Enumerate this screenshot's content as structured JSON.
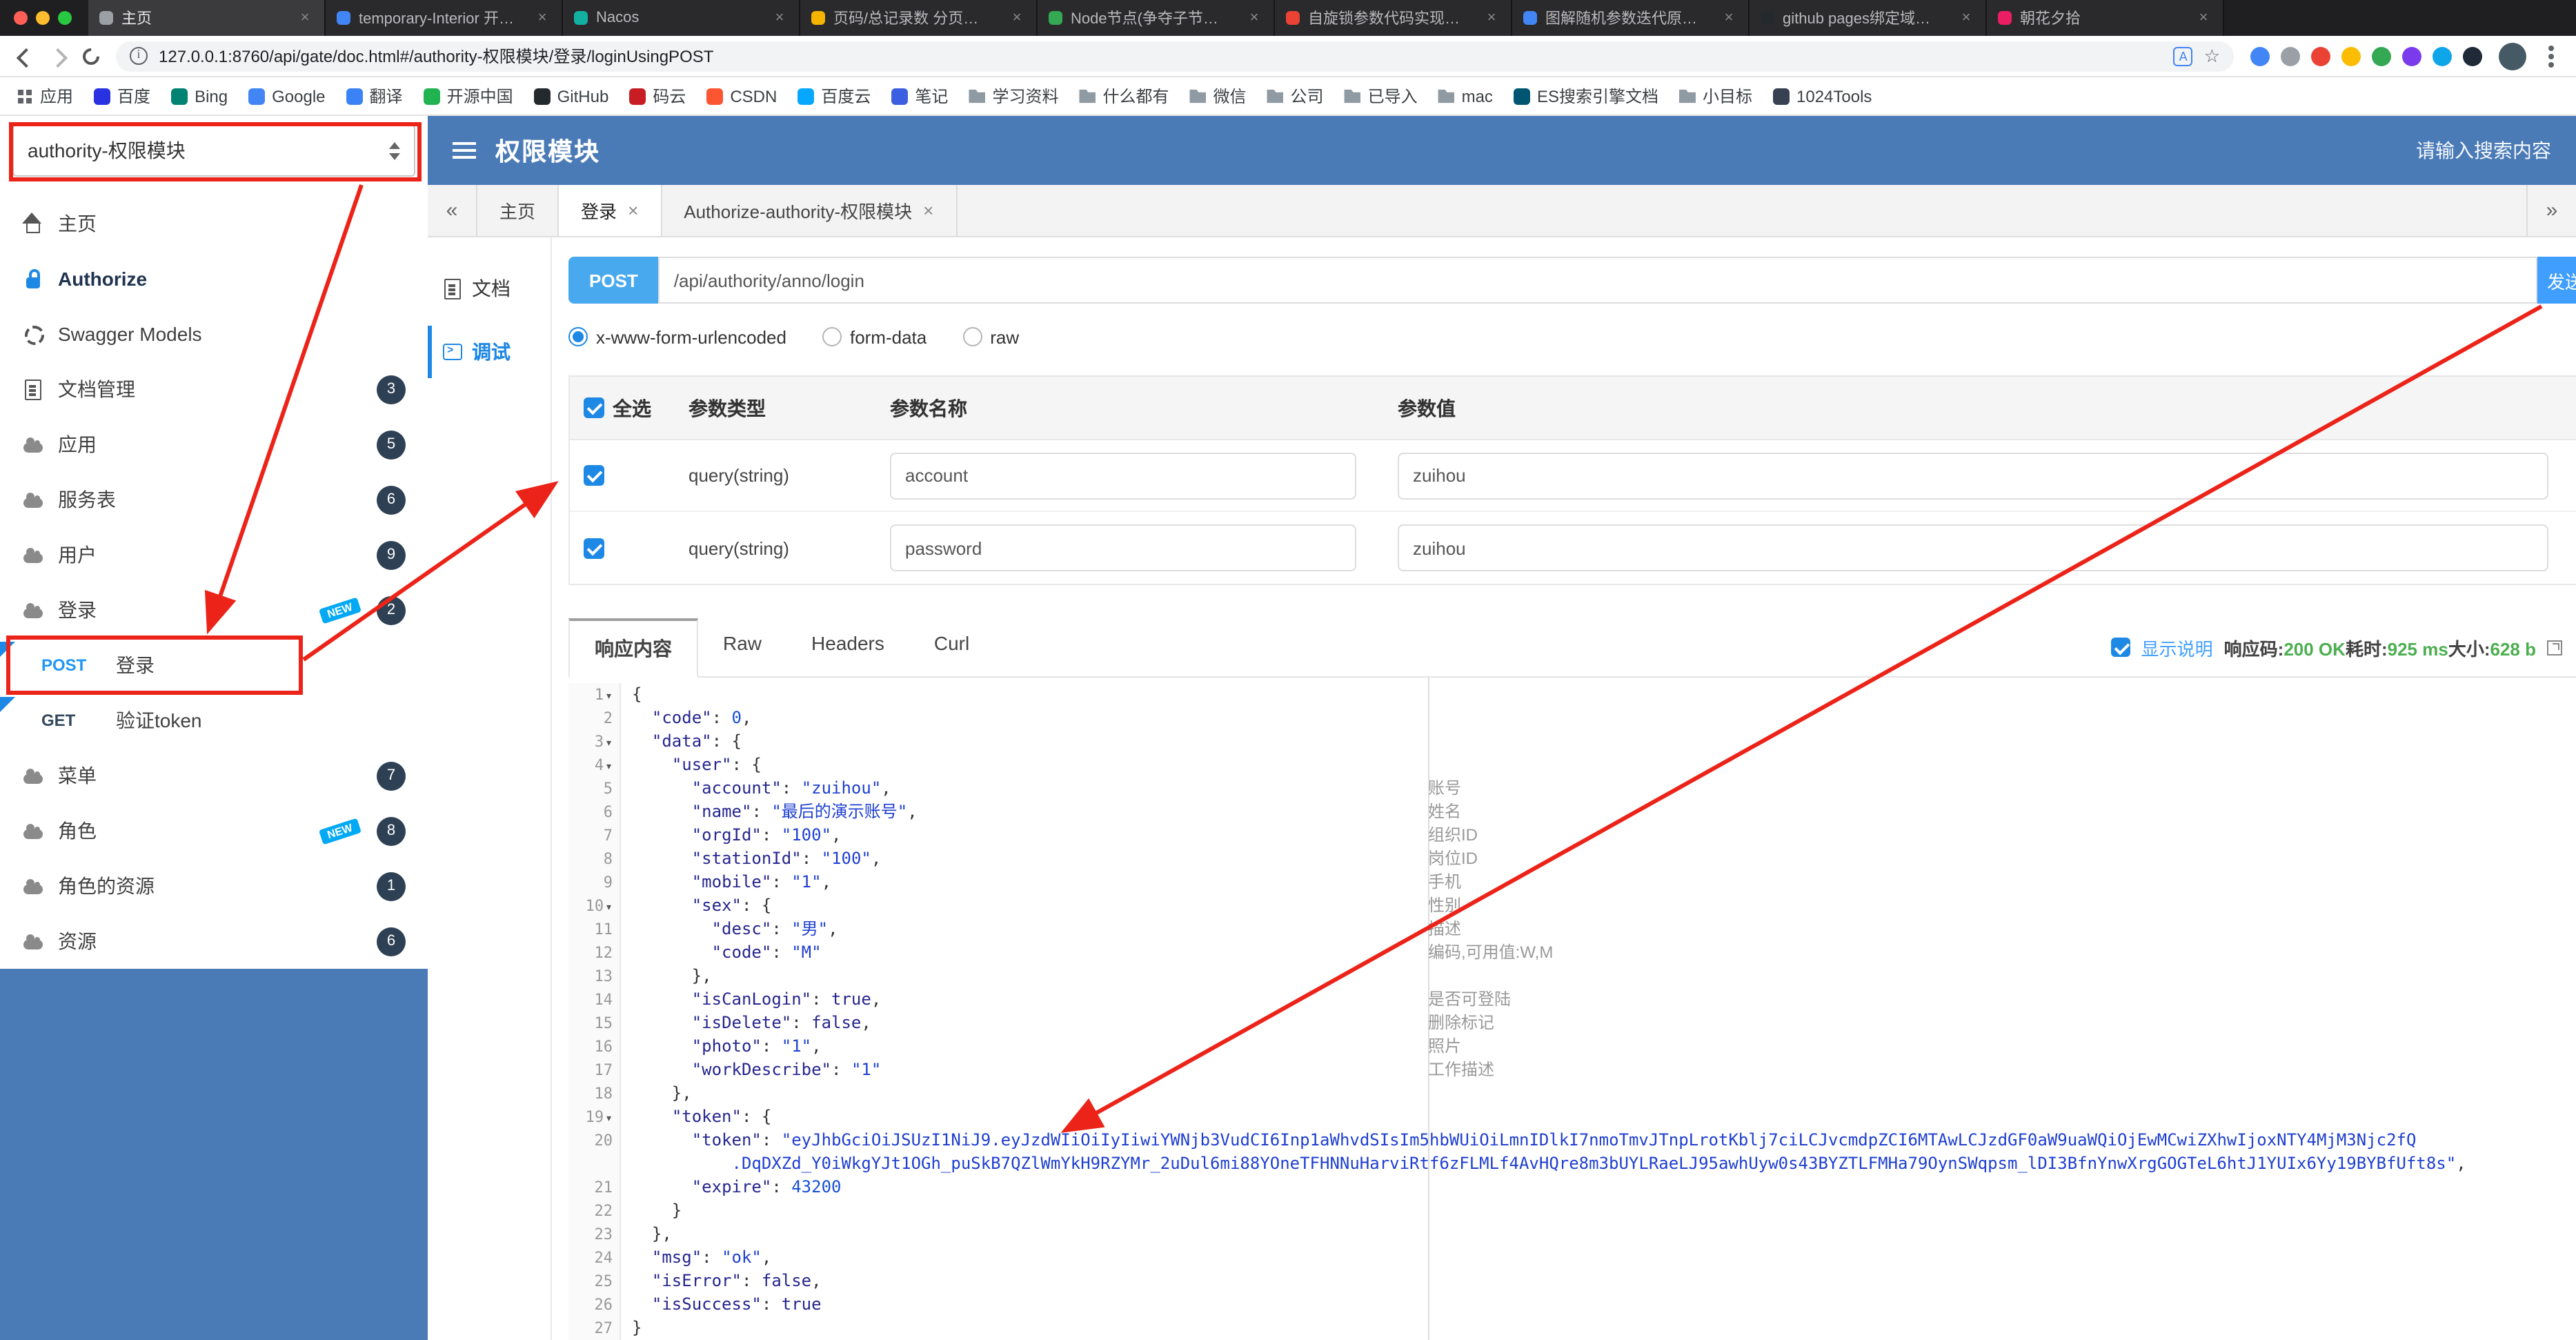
{
  "colors": {
    "header_blue": "#4a7bb7",
    "annotation_red": "#ec2318",
    "method_post_blue": "#2196f3",
    "status_green": "#4caf50",
    "badge_navy": "#2e4053"
  },
  "browser": {
    "url": "127.0.0.1:8760/api/gate/doc.html#/authority-权限模块/登录/loginUsingPOST",
    "tabs": [
      {
        "title": "主页",
        "color": "#9aa0a6"
      },
      {
        "title": "temporary-Interior 开…",
        "color": "#4285f4"
      },
      {
        "title": "Nacos",
        "color": "#12b0a0"
      },
      {
        "title": "页码/总记录数 分页…",
        "color": "#f4b400"
      },
      {
        "title": "Node节点(争夺子节…",
        "color": "#34a853"
      },
      {
        "title": "自旋锁参数代码实现…",
        "color": "#ea4335"
      },
      {
        "title": "图解随机参数迭代原…",
        "color": "#4285f4"
      },
      {
        "title": "github pages绑定域…",
        "color": "#24292e"
      },
      {
        "title": "朝花夕拾",
        "color": "#e91e63"
      }
    ],
    "actions": [
      {
        "color": "#4285f4"
      },
      {
        "color": "#9aa0a6"
      },
      {
        "color": "#ea4335"
      },
      {
        "color": "#fbbc04"
      },
      {
        "color": "#34a853"
      },
      {
        "color": "#7c3aed"
      },
      {
        "color": "#0ea5e9"
      },
      {
        "color": "#1f2937"
      }
    ],
    "bookmarks": [
      {
        "label": "应用",
        "type": "apps"
      },
      {
        "label": "百度",
        "color": "#2932e1"
      },
      {
        "label": "Bing",
        "color": "#008373"
      },
      {
        "label": "Google",
        "color": "#4285f4"
      },
      {
        "label": "翻译",
        "color": "#3b82f6"
      },
      {
        "label": "开源中国",
        "color": "#21b351"
      },
      {
        "label": "GitHub",
        "color": "#24292e"
      },
      {
        "label": "码云",
        "color": "#c71d23"
      },
      {
        "label": "CSDN",
        "color": "#fc5531"
      },
      {
        "label": "百度云",
        "color": "#06a7ff"
      },
      {
        "label": "笔记",
        "color": "#3b5fe0"
      },
      {
        "label": "学习资料",
        "folder": true
      },
      {
        "label": "什么都有",
        "folder": true
      },
      {
        "label": "微信",
        "folder": true
      },
      {
        "label": "公司",
        "folder": true
      },
      {
        "label": "已导入",
        "folder": true
      },
      {
        "label": "mac",
        "folder": true
      },
      {
        "label": "ES搜索引擎文档",
        "color": "#005571"
      },
      {
        "label": "小目标",
        "folder": true
      },
      {
        "label": "1024Tools",
        "color": "#374151"
      }
    ]
  },
  "header": {
    "group_select": "authority-权限模块",
    "title": "权限模块",
    "search_placeholder": "请输入搜索内容"
  },
  "sidebar": {
    "items": [
      {
        "label": "主页",
        "icon": "home"
      },
      {
        "label": "Authorize",
        "icon": "lock",
        "bold": true
      },
      {
        "label": "Swagger Models",
        "icon": "models"
      },
      {
        "label": "文档管理",
        "icon": "doc",
        "badge": "3"
      },
      {
        "label": "应用",
        "icon": "cloud",
        "badge": "5"
      },
      {
        "label": "服务表",
        "icon": "cloud",
        "badge": "6"
      },
      {
        "label": "用户",
        "icon": "cloud",
        "badge": "9"
      },
      {
        "label": "登录",
        "icon": "cloud",
        "badge": "2",
        "new_label": "NEW"
      },
      {
        "label": "登录",
        "method": "POST",
        "method_class": "post",
        "sub": true
      },
      {
        "label": "验证token",
        "method": "GET",
        "method_class": "get",
        "sub": true
      },
      {
        "label": "菜单",
        "icon": "cloud",
        "badge": "7"
      },
      {
        "label": "角色",
        "icon": "cloud",
        "badge": "8",
        "new_label": "NEW"
      },
      {
        "label": "角色的资源",
        "icon": "cloud",
        "badge": "1"
      },
      {
        "label": "资源",
        "icon": "cloud",
        "badge": "6"
      }
    ]
  },
  "doc_tabs": {
    "back": "«",
    "forward": "»",
    "items": [
      {
        "label": "主页"
      },
      {
        "label": "登录",
        "closable": true,
        "active": true
      },
      {
        "label": "Authorize-authority-权限模块",
        "closable": true
      }
    ]
  },
  "panel": {
    "items": [
      {
        "label": "文档",
        "icon": "doc"
      },
      {
        "label": "调试",
        "icon": "debug",
        "active": true
      }
    ]
  },
  "request": {
    "method": "POST",
    "url": "/api/authority/anno/login",
    "send_label": "发送",
    "content_types": [
      {
        "label": "x-www-form-urlencoded",
        "checked": true
      },
      {
        "label": "form-data"
      },
      {
        "label": "raw"
      }
    ]
  },
  "params": {
    "select_all": "全选",
    "col_type": "参数类型",
    "col_name": "参数名称",
    "col_value": "参数值",
    "rows": [
      {
        "type": "query(string)",
        "name": "account",
        "value": "zuihou",
        "checked": true
      },
      {
        "type": "query(string)",
        "name": "password",
        "value": "zuihou",
        "checked": true
      }
    ]
  },
  "response": {
    "tabs": [
      {
        "label": "响应内容",
        "active": true
      },
      {
        "label": "Raw"
      },
      {
        "label": "Headers"
      },
      {
        "label": "Curl"
      }
    ],
    "show_desc": "显示说明",
    "status_label": "响应码:",
    "status": "200 OK",
    "time_label": "耗时:",
    "time": "925 ms",
    "size_label": "大小:",
    "size": "628 b"
  },
  "code": {
    "rows": [
      {
        "ln": "1",
        "fold": true,
        "segs": [
          [
            "p",
            "{"
          ]
        ]
      },
      {
        "ln": "2",
        "segs": [
          [
            "p",
            "  "
          ],
          [
            "k",
            "\"code\""
          ],
          [
            "p",
            ": "
          ],
          [
            "n",
            "0"
          ],
          [
            "p",
            ","
          ]
        ]
      },
      {
        "ln": "3",
        "fold": true,
        "segs": [
          [
            "p",
            "  "
          ],
          [
            "k",
            "\"data\""
          ],
          [
            "p",
            ": {"
          ]
        ]
      },
      {
        "ln": "4",
        "fold": true,
        "segs": [
          [
            "p",
            "    "
          ],
          [
            "k",
            "\"user\""
          ],
          [
            "p",
            ": {"
          ]
        ]
      },
      {
        "ln": "5",
        "note": "账号",
        "segs": [
          [
            "p",
            "      "
          ],
          [
            "k",
            "\"account\""
          ],
          [
            "p",
            ": "
          ],
          [
            "s",
            "\"zuihou\""
          ],
          [
            "p",
            ","
          ]
        ]
      },
      {
        "ln": "6",
        "note": "姓名",
        "segs": [
          [
            "p",
            "      "
          ],
          [
            "k",
            "\"name\""
          ],
          [
            "p",
            ": "
          ],
          [
            "s",
            "\"最后的演示账号\""
          ],
          [
            "p",
            ","
          ]
        ]
      },
      {
        "ln": "7",
        "note": "组织ID",
        "segs": [
          [
            "p",
            "      "
          ],
          [
            "k",
            "\"orgId\""
          ],
          [
            "p",
            ": "
          ],
          [
            "s",
            "\"100\""
          ],
          [
            "p",
            ","
          ]
        ]
      },
      {
        "ln": "8",
        "note": "岗位ID",
        "segs": [
          [
            "p",
            "      "
          ],
          [
            "k",
            "\"stationId\""
          ],
          [
            "p",
            ": "
          ],
          [
            "s",
            "\"100\""
          ],
          [
            "p",
            ","
          ]
        ]
      },
      {
        "ln": "9",
        "note": "手机",
        "segs": [
          [
            "p",
            "      "
          ],
          [
            "k",
            "\"mobile\""
          ],
          [
            "p",
            ": "
          ],
          [
            "s",
            "\"1\""
          ],
          [
            "p",
            ","
          ]
        ]
      },
      {
        "ln": "10",
        "fold": true,
        "note": "性别",
        "segs": [
          [
            "p",
            "      "
          ],
          [
            "k",
            "\"sex\""
          ],
          [
            "p",
            ": {"
          ]
        ]
      },
      {
        "ln": "11",
        "note": "描述",
        "segs": [
          [
            "p",
            "        "
          ],
          [
            "k",
            "\"desc\""
          ],
          [
            "p",
            ": "
          ],
          [
            "s",
            "\"男\""
          ],
          [
            "p",
            ","
          ]
        ]
      },
      {
        "ln": "12",
        "note": "编码,可用值:W,M",
        "segs": [
          [
            "p",
            "        "
          ],
          [
            "k",
            "\"code\""
          ],
          [
            "p",
            ": "
          ],
          [
            "s",
            "\"M\""
          ]
        ]
      },
      {
        "ln": "13",
        "segs": [
          [
            "p",
            "      },"
          ]
        ]
      },
      {
        "ln": "14",
        "note": "是否可登陆",
        "segs": [
          [
            "p",
            "      "
          ],
          [
            "k",
            "\"isCanLogin\""
          ],
          [
            "p",
            ": "
          ],
          [
            "b",
            "true"
          ],
          [
            "p",
            ","
          ]
        ]
      },
      {
        "ln": "15",
        "note": "删除标记",
        "segs": [
          [
            "p",
            "      "
          ],
          [
            "k",
            "\"isDelete\""
          ],
          [
            "p",
            ": "
          ],
          [
            "b",
            "false"
          ],
          [
            "p",
            ","
          ]
        ]
      },
      {
        "ln": "16",
        "note": "照片",
        "segs": [
          [
            "p",
            "      "
          ],
          [
            "k",
            "\"photo\""
          ],
          [
            "p",
            ": "
          ],
          [
            "s",
            "\"1\""
          ],
          [
            "p",
            ","
          ]
        ]
      },
      {
        "ln": "17",
        "note": "工作描述",
        "segs": [
          [
            "p",
            "      "
          ],
          [
            "k",
            "\"workDescribe\""
          ],
          [
            "p",
            ": "
          ],
          [
            "s",
            "\"1\""
          ]
        ]
      },
      {
        "ln": "18",
        "segs": [
          [
            "p",
            "    },"
          ]
        ]
      },
      {
        "ln": "19",
        "fold": true,
        "segs": [
          [
            "p",
            "    "
          ],
          [
            "k",
            "\"token\""
          ],
          [
            "p",
            ": {"
          ]
        ]
      },
      {
        "ln": "20",
        "segs": [
          [
            "p",
            "      "
          ],
          [
            "k",
            "\"token\""
          ],
          [
            "p",
            ": "
          ],
          [
            "s",
            "\"eyJhbGciOiJSUzI1NiJ9.eyJzdWIiOiIyIiwiYWNjb3VudCI6Inp1aWhvdSIsIm5hbWUiOiLmnIDlkI7nmoTmvJTnpLrotKblj7ciLCJvcmdpZCI6MTAwLCJzdGF0aW9uaWQiOjEwMCwiZXhwIjoxNTY4MjM3Njc2fQ"
          ]
        ]
      },
      {
        "ln": "",
        "segs": [
          [
            "s",
            "          .DqDXZd_Y0iWkgYJt1OGh_puSkB7QZlWmYkH9RZYMr_2uDul6mi88YOneTFHNNuHarviRtf6zFLMLf4AvHQre8m3bUYLRaeLJ95awhUyw0s43BYZTLFMHa79OynSWqpsm_lDI3BfnYnwXrgGOGTeL6htJ1YUIx6Yy19BYBfUft8s\""
          ],
          [
            "p",
            ","
          ]
        ]
      },
      {
        "ln": "21",
        "segs": [
          [
            "p",
            "      "
          ],
          [
            "k",
            "\"expire\""
          ],
          [
            "p",
            ": "
          ],
          [
            "n",
            "43200"
          ]
        ]
      },
      {
        "ln": "22",
        "segs": [
          [
            "p",
            "    }"
          ]
        ]
      },
      {
        "ln": "23",
        "segs": [
          [
            "p",
            "  },"
          ]
        ]
      },
      {
        "ln": "24",
        "segs": [
          [
            "p",
            "  "
          ],
          [
            "k",
            "\"msg\""
          ],
          [
            "p",
            ": "
          ],
          [
            "s",
            "\"ok\""
          ],
          [
            "p",
            ","
          ]
        ]
      },
      {
        "ln": "25",
        "segs": [
          [
            "p",
            "  "
          ],
          [
            "k",
            "\"isError\""
          ],
          [
            "p",
            ": "
          ],
          [
            "b",
            "false"
          ],
          [
            "p",
            ","
          ]
        ]
      },
      {
        "ln": "26",
        "segs": [
          [
            "p",
            "  "
          ],
          [
            "k",
            "\"isSuccess\""
          ],
          [
            "p",
            ": "
          ],
          [
            "b",
            "true"
          ]
        ]
      },
      {
        "ln": "27",
        "segs": [
          [
            "p",
            "}"
          ]
        ]
      }
    ]
  }
}
